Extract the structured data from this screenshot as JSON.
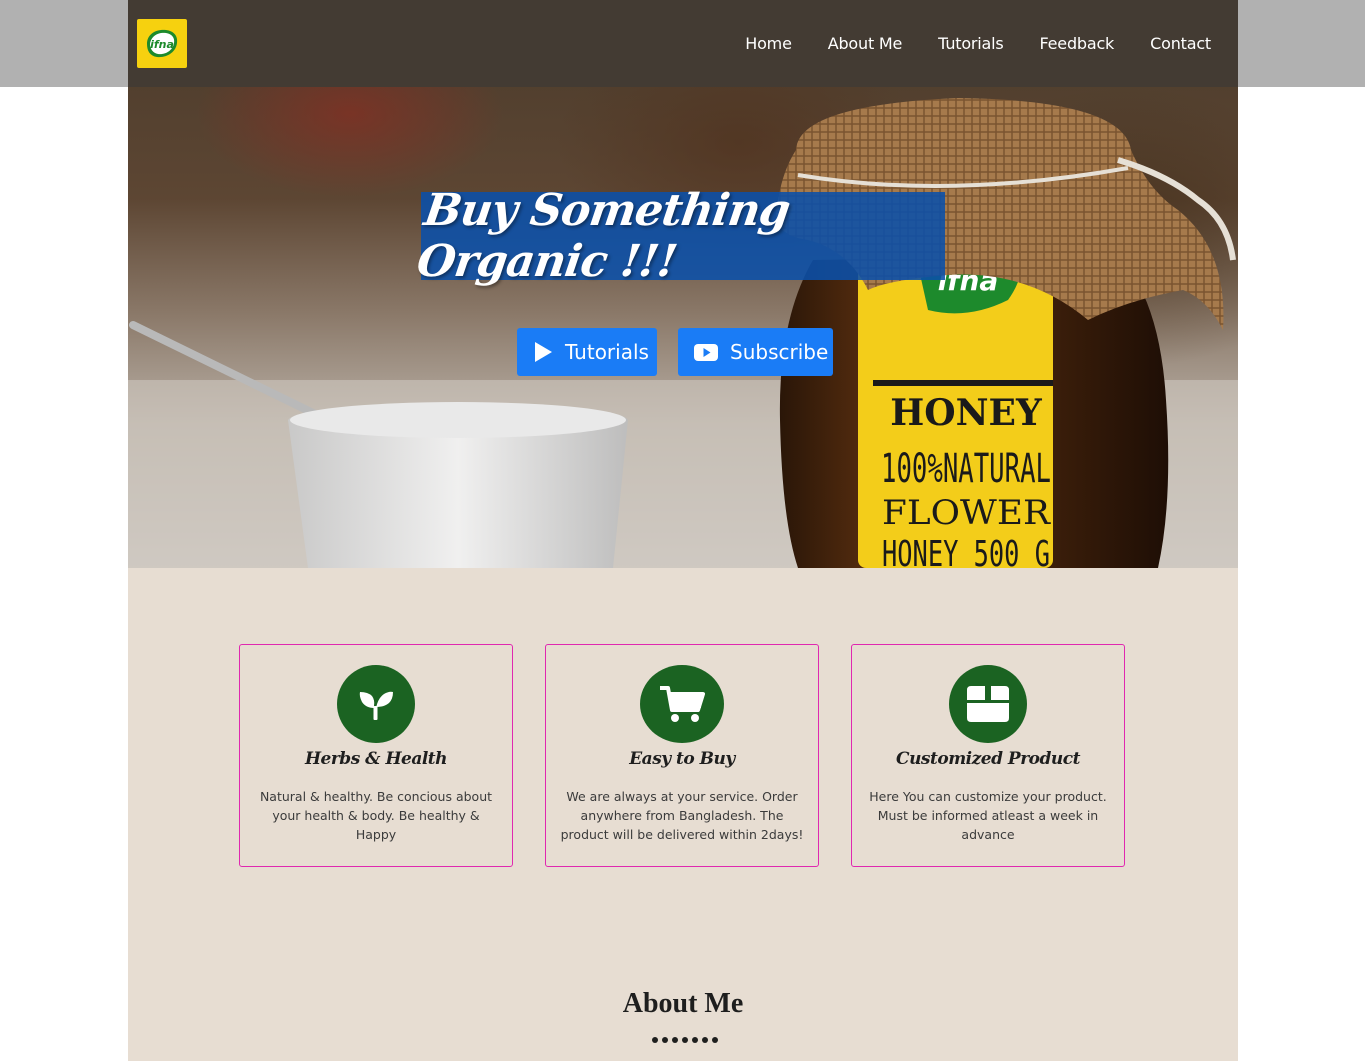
{
  "brand": {
    "logo_text": "ifna",
    "logo_color": "#f6d10f"
  },
  "nav": {
    "items": [
      {
        "label": "Home"
      },
      {
        "label": "About Me"
      },
      {
        "label": "Tutorials"
      },
      {
        "label": "Feedback"
      },
      {
        "label": "Contact"
      }
    ]
  },
  "hero": {
    "headline": "Buy Something Organic !!!",
    "buttons": {
      "tutorials": {
        "label": "Tutorials",
        "icon": "play-icon"
      },
      "subscribe": {
        "label": "Subscribe",
        "icon": "youtube-icon"
      }
    },
    "jar_label": {
      "brand": "ifna",
      "product": "HONEY",
      "line2": "100%NATURAL",
      "line3": "FLOWER",
      "line4": "HONEY 500 G"
    },
    "button_color": "#1a7cf6",
    "banner_color": "#0a50aa"
  },
  "features": {
    "cards": [
      {
        "icon": "seedling-icon",
        "title": "Herbs & Health",
        "text": "Natural & healthy. Be concious about your health & body. Be healthy & Happy"
      },
      {
        "icon": "cart-icon",
        "title": "Easy to Buy",
        "text": "We are always at your service. Order anywhere from Bangladesh. The product will be delivered within 2days!"
      },
      {
        "icon": "box-icon",
        "title": "Customized Product",
        "text": "Here You can customize your product. Must be informed atleast a week in advance"
      }
    ],
    "icon_bg": "#1b6322",
    "border_color": "#e028b0"
  },
  "about": {
    "title": "About Me"
  }
}
